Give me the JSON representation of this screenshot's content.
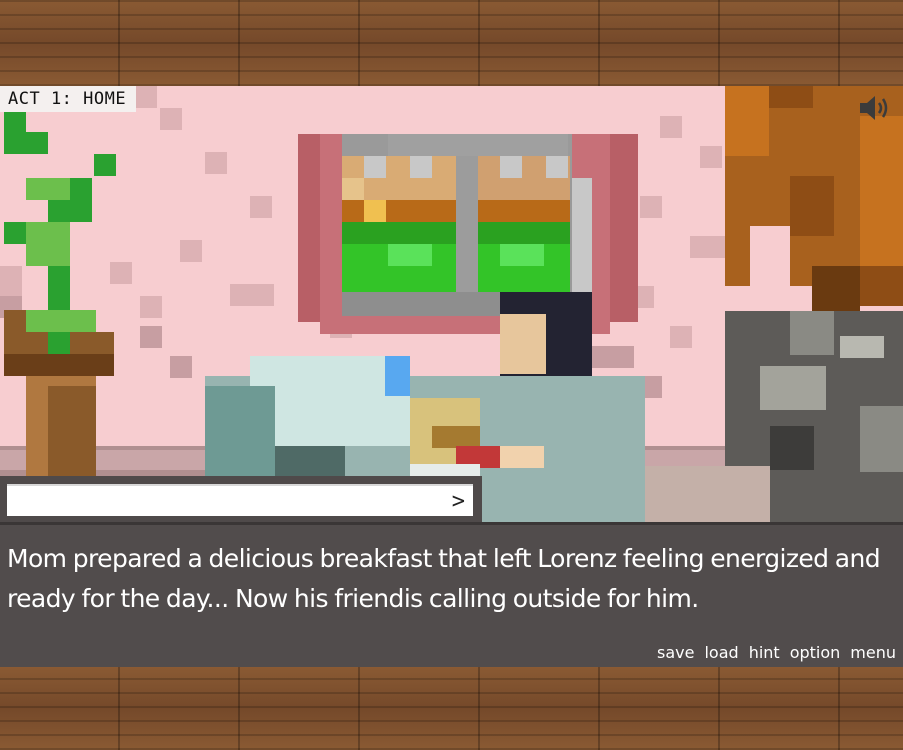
{
  "chapter": "ACT 1: HOME",
  "dialogue": {
    "name": "",
    "text": "Mom prepared a delicious breakfast that left Lorenz feeling energized and ready for the day... Now his friendis calling outside for him."
  },
  "name_box_arrow": ">",
  "quick_menu": {
    "save": "save",
    "load": "load",
    "hint": "hint",
    "option": "option",
    "menu": "menu"
  },
  "icons": {
    "sound": "speaker-icon"
  },
  "colors": {
    "wall": "#f7cdd0",
    "dialog_bg": "#514c4c",
    "wood": "#7a4f2c"
  }
}
